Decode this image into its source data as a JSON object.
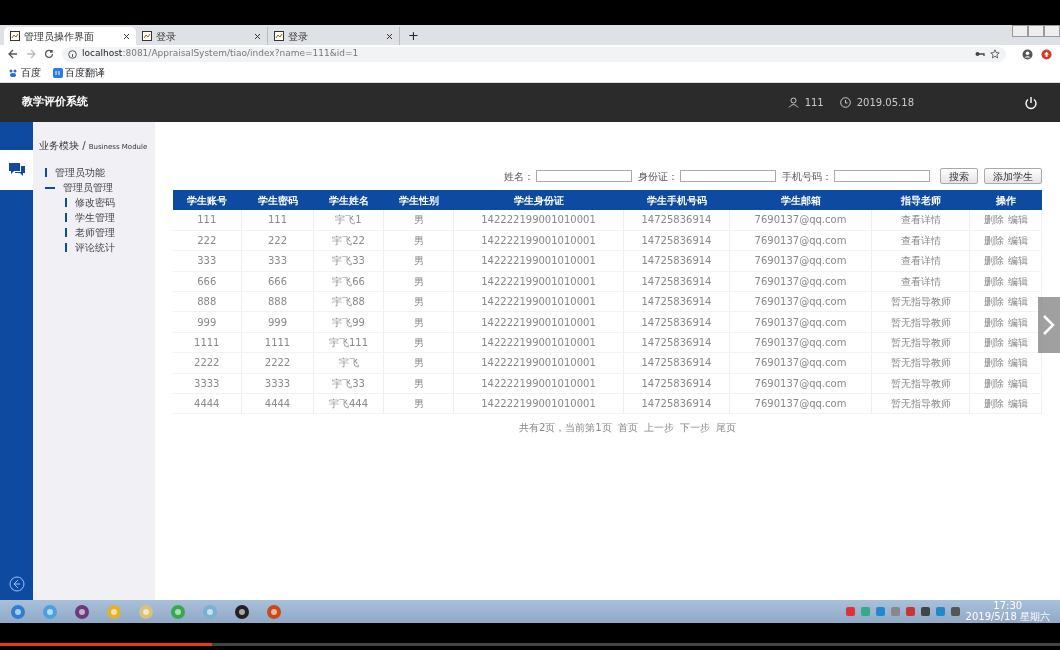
{
  "browser": {
    "tabs": [
      {
        "title": "管理员操作界面",
        "selected": true
      },
      {
        "title": "登录",
        "selected": false
      },
      {
        "title": "登录",
        "selected": false
      }
    ],
    "new_tab": "+",
    "url_host": "localhost",
    "url_rest": ":8081/AppraisalSystem/tiao/index?name=111&id=1",
    "bookmarks": [
      "百度",
      "百度翻译"
    ]
  },
  "app": {
    "title": "教学评价系统",
    "user": "111",
    "date": "2019.05.18"
  },
  "sidebar": {
    "heading": "业务模块",
    "separator": "/",
    "subheading": "Business Module",
    "items": [
      {
        "label": "管理员功能",
        "expanded": false
      },
      {
        "label": "管理员管理",
        "expanded": true,
        "children": [
          {
            "label": "修改密码"
          },
          {
            "label": "学生管理"
          },
          {
            "label": "老师管理"
          },
          {
            "label": "评论统计"
          }
        ]
      }
    ]
  },
  "search": {
    "fields": [
      {
        "label": "姓名："
      },
      {
        "label": "身份证："
      },
      {
        "label": "手机号码："
      }
    ],
    "buttons": [
      "搜索",
      "添加学生"
    ]
  },
  "table": {
    "columns": [
      "学生账号",
      "学生密码",
      "学生姓名",
      "学生性别",
      "学生身份证",
      "学生手机号码",
      "学生邮箱",
      "指导老师",
      "操作"
    ],
    "rows": [
      {
        "cells": [
          "111",
          "111",
          "宇飞1",
          "男",
          "142222199001010001",
          "14725836914",
          "7690137@qq.com",
          "查看详情"
        ],
        "actions": [
          "删除",
          "编辑"
        ]
      },
      {
        "cells": [
          "222",
          "222",
          "宇飞22",
          "男",
          "142222199001010001",
          "14725836914",
          "7690137@qq.com",
          "查看详情"
        ],
        "actions": [
          "删除",
          "编辑"
        ]
      },
      {
        "cells": [
          "333",
          "333",
          "宇飞33",
          "男",
          "142222199001010001",
          "14725836914",
          "7690137@qq.com",
          "查看详情"
        ],
        "actions": [
          "删除",
          "编辑"
        ]
      },
      {
        "cells": [
          "666",
          "666",
          "宇飞66",
          "男",
          "142222199001010001",
          "14725836914",
          "7690137@qq.com",
          "查看详情"
        ],
        "actions": [
          "删除",
          "编辑"
        ]
      },
      {
        "cells": [
          "888",
          "888",
          "宇飞88",
          "男",
          "142222199001010001",
          "14725836914",
          "7690137@qq.com",
          "暂无指导教师"
        ],
        "actions": [
          "删除",
          "编辑"
        ]
      },
      {
        "cells": [
          "999",
          "999",
          "宇飞99",
          "男",
          "142222199001010001",
          "14725836914",
          "7690137@qq.com",
          "暂无指导教师"
        ],
        "actions": [
          "删除",
          "编辑"
        ]
      },
      {
        "cells": [
          "1111",
          "1111",
          "宇飞111",
          "男",
          "142222199001010001",
          "14725836914",
          "7690137@qq.com",
          "暂无指导教师"
        ],
        "actions": [
          "删除",
          "编辑"
        ]
      },
      {
        "cells": [
          "2222",
          "2222",
          "宇飞",
          "男",
          "142222199001010001",
          "14725836914",
          "7690137@qq.com",
          "暂无指导教师"
        ],
        "actions": [
          "删除",
          "编辑"
        ]
      },
      {
        "cells": [
          "3333",
          "3333",
          "宇飞33",
          "男",
          "142222199001010001",
          "14725836914",
          "7690137@qq.com",
          "暂无指导教师"
        ],
        "actions": [
          "删除",
          "编辑"
        ]
      },
      {
        "cells": [
          "4444",
          "4444",
          "宇飞444",
          "男",
          "142222199001010001",
          "14725836914",
          "7690137@qq.com",
          "暂无指导教师"
        ],
        "actions": [
          "删除",
          "编辑"
        ]
      }
    ]
  },
  "pagination": {
    "summary": "共有2页，当前第1页",
    "links": [
      "首页",
      "上一步",
      "下一步",
      "尾页"
    ]
  },
  "taskbar": {
    "time": "17:30",
    "date": "2019/5/18 星期六"
  },
  "video": {
    "level": 0.2
  }
}
